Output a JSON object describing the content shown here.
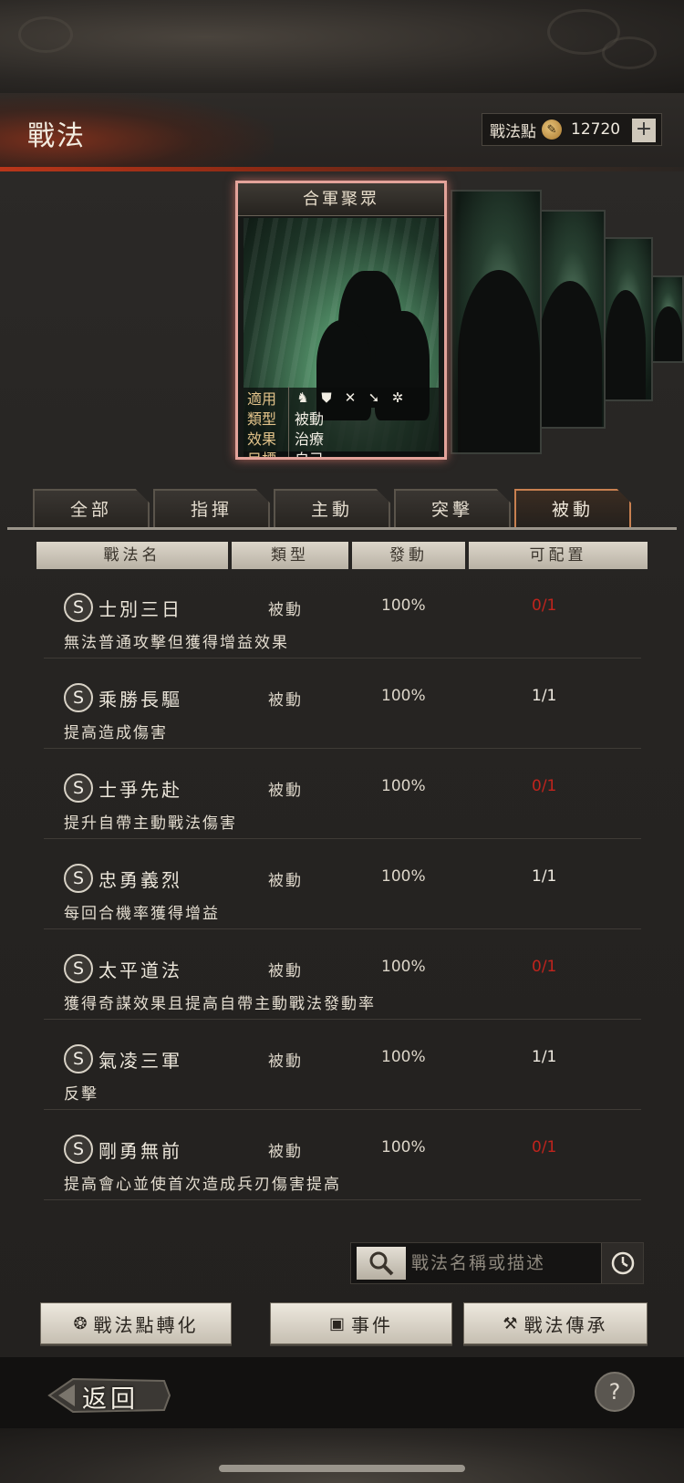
{
  "header": {
    "title": "戰法",
    "points_label": "戰法點",
    "points_value": "12720",
    "plus": "+"
  },
  "card": {
    "name": "合軍聚眾",
    "rows": [
      {
        "key": "適用",
        "value": ""
      },
      {
        "key": "類型",
        "value": "被動"
      },
      {
        "key": "效果",
        "value": "治療"
      },
      {
        "key": "目標",
        "value": "自己"
      }
    ],
    "unit_icons": [
      "cavalry-icon",
      "shield-icon",
      "crossbow-icon",
      "spear-icon",
      "chariot-icon"
    ]
  },
  "tabs": [
    {
      "label": "全部"
    },
    {
      "label": "指揮"
    },
    {
      "label": "主動"
    },
    {
      "label": "突擊"
    },
    {
      "label": "被動",
      "active": true
    }
  ],
  "columns": {
    "name": "戰法名",
    "type": "類型",
    "trigger": "發動",
    "assignable": "可配置"
  },
  "skills": [
    {
      "grade": "S",
      "name": "士別三日",
      "type": "被動",
      "rate": "100%",
      "config": "0/1",
      "config_full": true,
      "desc": "無法普通攻擊但獲得增益效果"
    },
    {
      "grade": "S",
      "name": "乘勝長驅",
      "type": "被動",
      "rate": "100%",
      "config": "1/1",
      "config_full": false,
      "desc": "提高造成傷害"
    },
    {
      "grade": "S",
      "name": "士爭先赴",
      "type": "被動",
      "rate": "100%",
      "config": "0/1",
      "config_full": true,
      "desc": "提升自帶主動戰法傷害"
    },
    {
      "grade": "S",
      "name": "忠勇義烈",
      "type": "被動",
      "rate": "100%",
      "config": "1/1",
      "config_full": false,
      "desc": "每回合機率獲得增益"
    },
    {
      "grade": "S",
      "name": "太平道法",
      "type": "被動",
      "rate": "100%",
      "config": "0/1",
      "config_full": true,
      "desc": "獲得奇謀效果且提高自帶主動戰法發動率"
    },
    {
      "grade": "S",
      "name": "氣凌三軍",
      "type": "被動",
      "rate": "100%",
      "config": "1/1",
      "config_full": false,
      "desc": "反擊"
    },
    {
      "grade": "S",
      "name": "剛勇無前",
      "type": "被動",
      "rate": "100%",
      "config": "0/1",
      "config_full": true,
      "desc": "提高會心並使首次造成兵刃傷害提高"
    }
  ],
  "search": {
    "placeholder": "戰法名稱或描述"
  },
  "buttons": {
    "convert": "戰法點轉化",
    "event": "事件",
    "inherit": "戰法傳承"
  },
  "footer": {
    "back": "返回",
    "help": "?"
  },
  "colors": {
    "accent_red": "#c0241d",
    "tab_active_border": "#c88050",
    "card_border": "#e3a39a"
  }
}
